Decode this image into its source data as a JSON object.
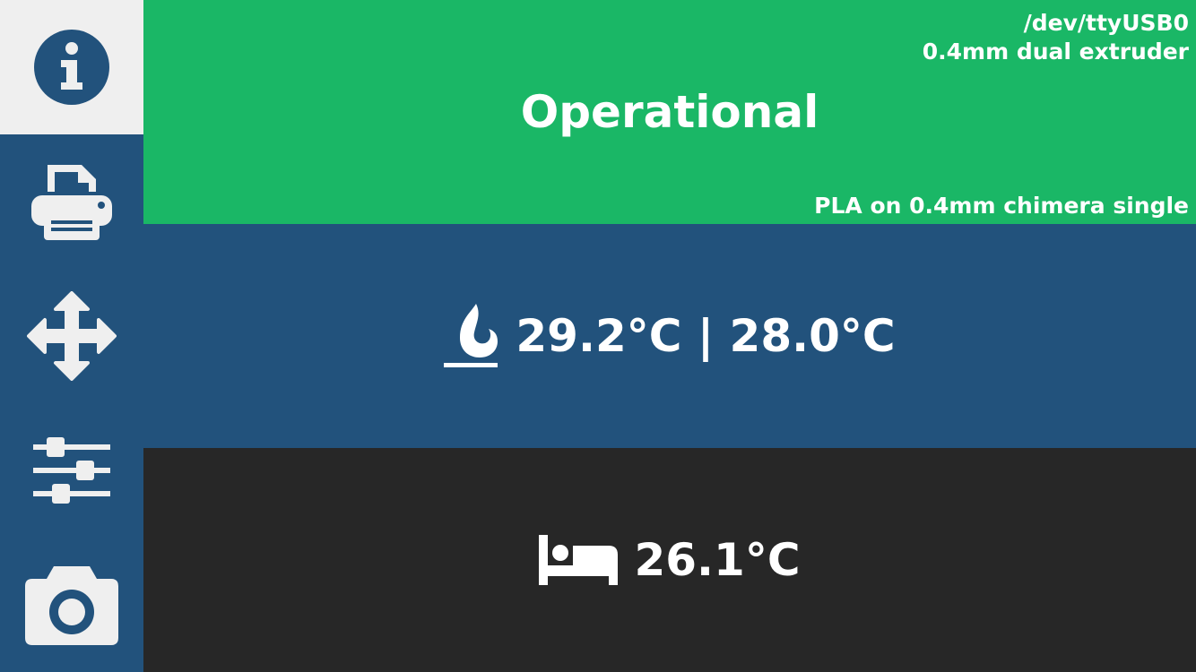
{
  "sidebar": {
    "items": [
      {
        "name": "info",
        "icon": "info-circle-icon",
        "active": true
      },
      {
        "name": "print",
        "icon": "printer-icon",
        "active": false
      },
      {
        "name": "move",
        "icon": "move-arrows-icon",
        "active": false
      },
      {
        "name": "settings",
        "icon": "sliders-icon",
        "active": false
      },
      {
        "name": "camera",
        "icon": "camera-icon",
        "active": false
      }
    ]
  },
  "status": {
    "text": "Operational",
    "port": "/dev/ttyUSB0",
    "printer_profile": "0.4mm dual extruder",
    "material_profile": "PLA on 0.4mm chimera single"
  },
  "tool": {
    "icon": "flame-icon",
    "temperature": "29.2°C | 28.0°C"
  },
  "bed": {
    "icon": "bed-icon",
    "temperature": "26.1°C"
  },
  "colors": {
    "status_bg": "#1ab766",
    "sidebar_bg": "#22527c",
    "tool_bg": "#22527c",
    "bed_bg": "#272727",
    "active_nav_bg": "#efefef"
  }
}
